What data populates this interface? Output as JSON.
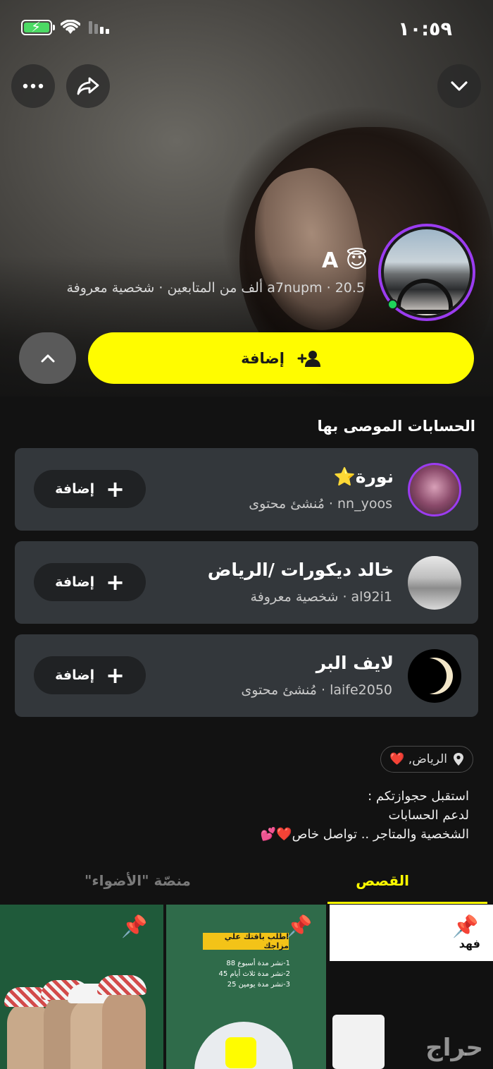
{
  "status_bar": {
    "time": "١٠:٥٩"
  },
  "header": {
    "more_icon": "ellipsis-icon",
    "share_icon": "share-icon",
    "collapse_icon": "chevron-down-icon"
  },
  "profile": {
    "name": "A",
    "emoji": "😇",
    "meta": "a7nupm · 20.5 ألف من المتابعين · شخصية معروفة",
    "add_label": "إضافة",
    "online": true
  },
  "recommended": {
    "title": "الحسابات الموصى بها",
    "items": [
      {
        "name": "نورة⭐️",
        "sub": "nn_yoos · مُنشئ محتوى",
        "add_label": "إضافة"
      },
      {
        "name": "خالد ديكورات /الرياض",
        "sub": "al92i1 · شخصية معروفة",
        "add_label": "إضافة"
      },
      {
        "name": "لايف البر",
        "sub": "laife2050 · مُنشئ محتوى",
        "add_label": "إضافة"
      }
    ]
  },
  "bio": {
    "location": "الرياض, ❤️",
    "lines": [
      "استقبل حجوازتكم :",
      "لدعم الحسابات",
      "الشخصية والمتاجر .. تواصل خاص❤️💕"
    ]
  },
  "tabs": {
    "stories": "القصص",
    "spotlight": "منصّة \"الأضواء\""
  },
  "thumbs": {
    "t2_banner": "اطلب باقتك علي مزاجك",
    "t2_lines": [
      "1-نشر مدة أسبوع 88",
      "2-نشر مدة ثلاث أيام 45",
      "3-نشر مدة يومين 25"
    ],
    "t3_name": "فهد",
    "watermark": "حراج"
  }
}
